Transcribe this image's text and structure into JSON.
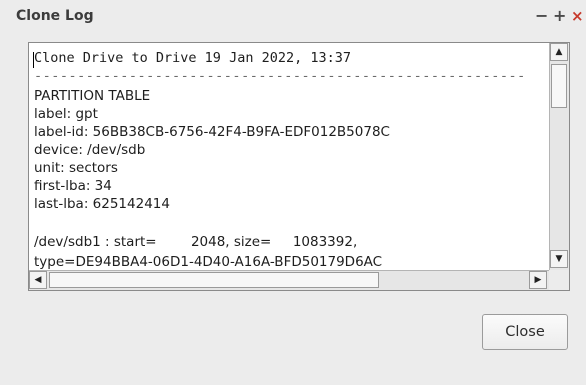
{
  "window": {
    "title": "Clone Log",
    "controls": {
      "minimize": "−",
      "maximize": "+",
      "close": "×"
    }
  },
  "log": {
    "lines": [
      "Clone Drive to Drive 19 Jan 2022, 13:37",
      "---------------------------------------------------------",
      "PARTITION TABLE",
      "label: gpt",
      "label-id: 56BB38CB-6756-42F4-B9FA-EDF012B5078C",
      "device: /dev/sdb",
      "unit: sectors",
      "first-lba: 34",
      "last-lba: 625142414",
      "",
      "/dev/sdb1 : start=        2048, size=     1083392,",
      "type=DE94BBA4-06D1-4D40-A16A-BFD50179D6AC"
    ]
  },
  "scrollbars": {
    "up_arrow": "▲",
    "down_arrow": "▼",
    "left_arrow": "◀",
    "right_arrow": "▶"
  },
  "buttons": {
    "close_label": "Close"
  }
}
